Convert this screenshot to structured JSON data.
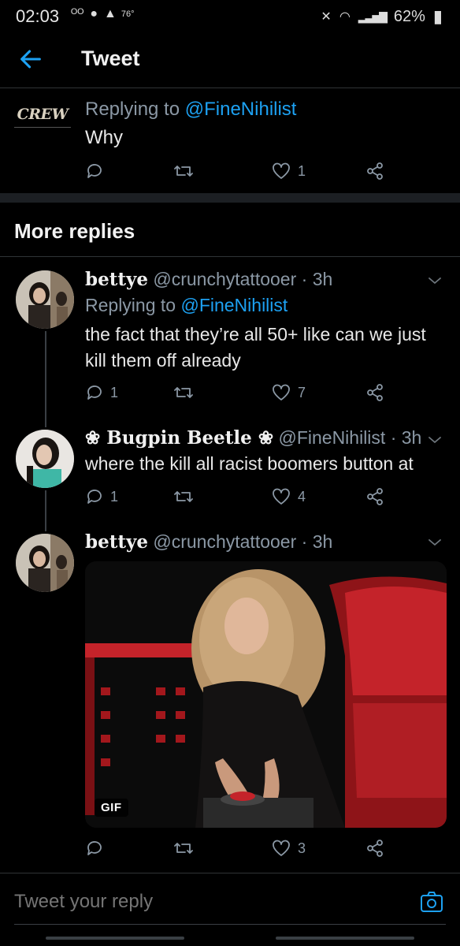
{
  "status_bar": {
    "time": "02:03",
    "temperature": "76°",
    "battery": "62%"
  },
  "header": {
    "title": "Tweet"
  },
  "first_tweet": {
    "avatar_text": "CREW",
    "replying_label": "Replying to",
    "replying_handle": "@FineNihilist",
    "text": "Why",
    "likes": "1"
  },
  "section": {
    "more_replies": "More replies"
  },
  "replies": [
    {
      "name": "bettye",
      "handle": "@crunchytattooer",
      "time": "· 3h",
      "replying_label": "Replying to",
      "replying_handle": "@FineNihilist",
      "text": "the fact that they’re all 50+ like can we just kill them off already",
      "replies": "1",
      "likes": "7"
    },
    {
      "name": "Bugpin Beetle",
      "name_decor": "❀",
      "handle": "@FineNihilist",
      "time": "· 3h",
      "text": "where the kill all racist boomers button at",
      "replies": "1",
      "likes": "4"
    },
    {
      "name": "bettye",
      "handle": "@crunchytattooer",
      "time": "· 3h",
      "media_badge": "GIF",
      "likes": "3"
    }
  ],
  "compose": {
    "placeholder": "Tweet your reply"
  },
  "colors": {
    "accent": "#1da1f2",
    "background": "#000000",
    "muted": "#8b98a5"
  }
}
